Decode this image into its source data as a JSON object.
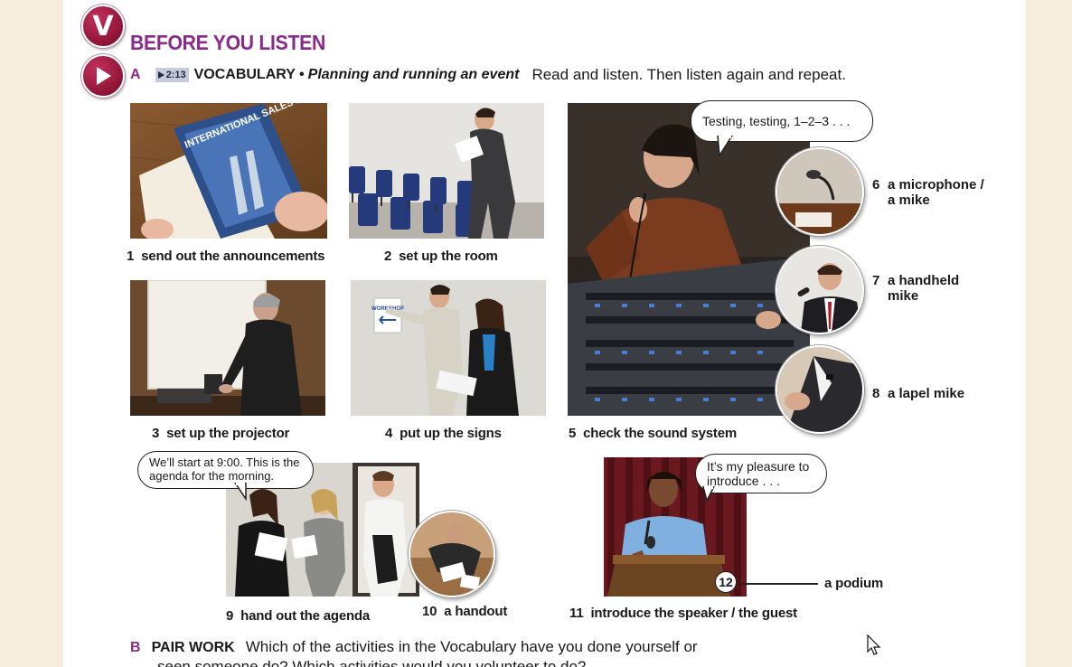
{
  "header": {
    "unit_badge": "V",
    "section_title": "BEFORE YOU LISTEN"
  },
  "exercise_a": {
    "letter": "A",
    "track": "2:13",
    "vocab_label": "VOCABULARY •",
    "topic": "Planning and running an event",
    "instructions": "Read and listen. Then listen again and repeat."
  },
  "photos": {
    "brochure_text": "INTERNATIONAL SALES MEETING",
    "sign_text": "WORKSHOP"
  },
  "items": [
    {
      "num": "1",
      "label": "send out the announcements"
    },
    {
      "num": "2",
      "label": "set up the room"
    },
    {
      "num": "3",
      "label": "set up the projector"
    },
    {
      "num": "4",
      "label": "put up the signs"
    },
    {
      "num": "5",
      "label": "check the sound system"
    },
    {
      "num": "6",
      "label_line1": "a microphone /",
      "label_line2": "a mike"
    },
    {
      "num": "7",
      "label_line1": "a handheld",
      "label_line2": "mike"
    },
    {
      "num": "8",
      "label": "a lapel mike"
    },
    {
      "num": "9",
      "label": "hand out the agenda"
    },
    {
      "num": "10",
      "label": "a handout"
    },
    {
      "num": "11",
      "label": "introduce the speaker / the guest"
    },
    {
      "num": "12",
      "label": "a podium"
    }
  ],
  "bubbles": {
    "sound": "Testing, testing, 1–2–3 . . .",
    "agenda": "We’ll start at 9:00. This is the agenda for the morning.",
    "speaker": "It’s my pleasure to introduce . . ."
  },
  "exercise_b": {
    "letter": "B",
    "label": "PAIR WORK",
    "line1": "Which of the activities in the Vocabulary have you done yourself or",
    "line2": "seen someone do? Which activities would you volunteer to do?"
  },
  "colors": {
    "accent_purple": "#8a2a8a",
    "badge_red": "#8e1436",
    "page_background": "#f7eddc"
  }
}
